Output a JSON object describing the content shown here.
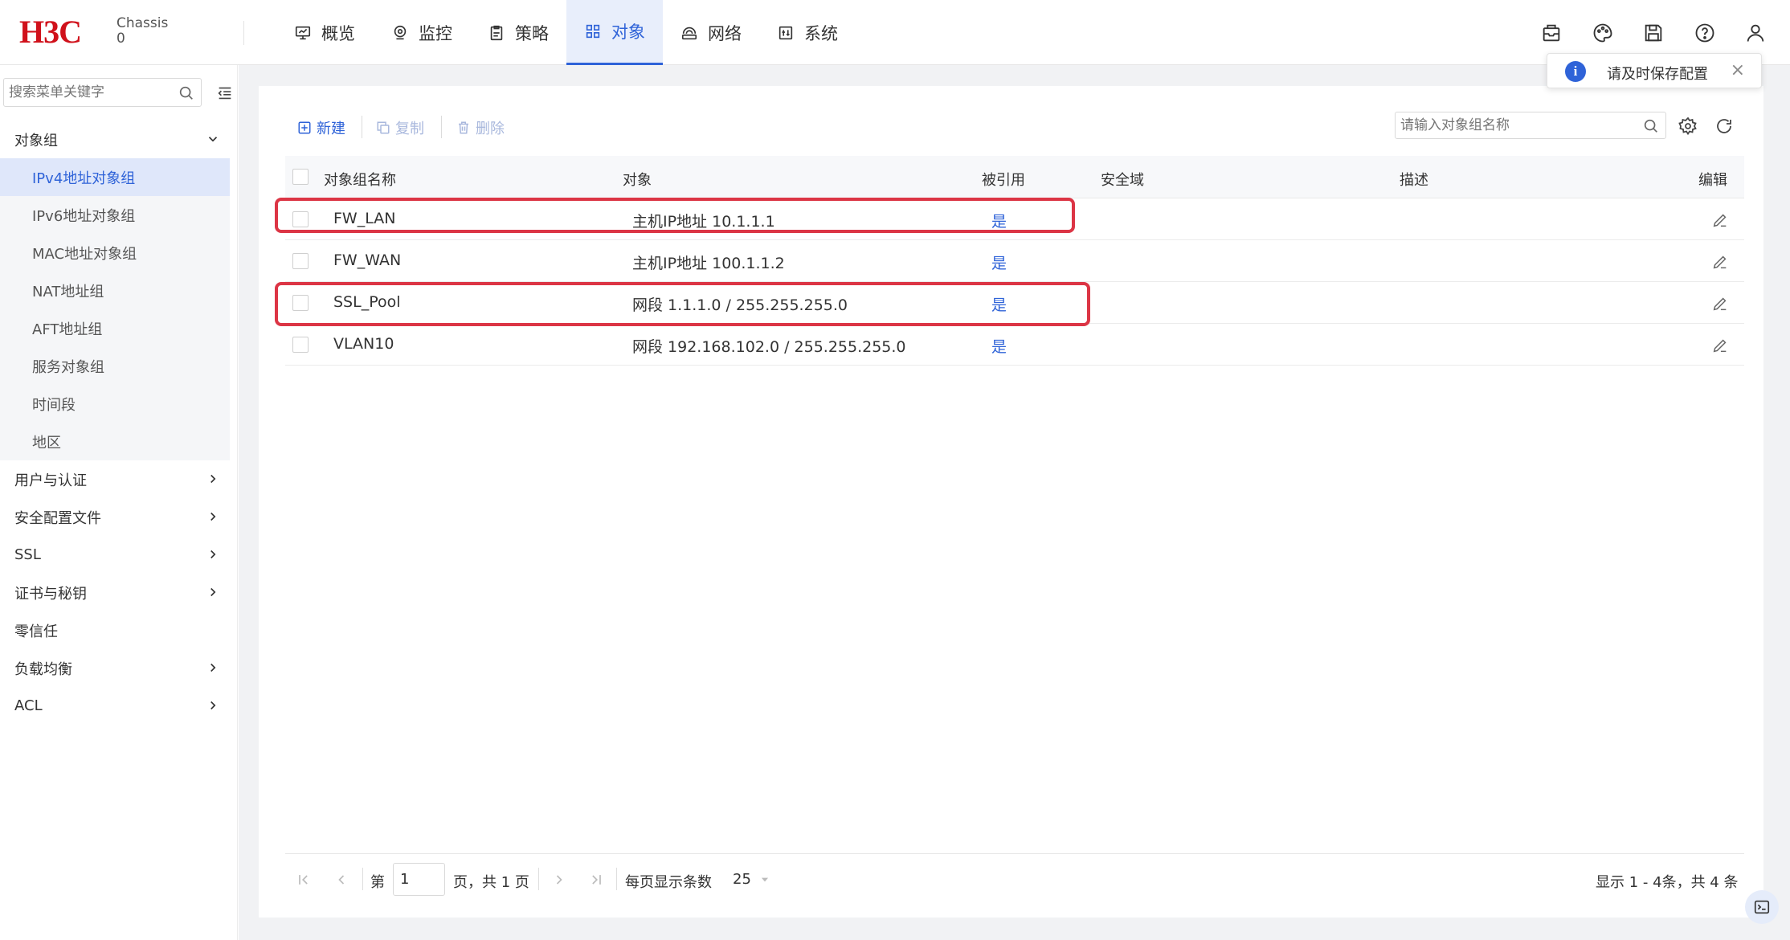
{
  "brand": {
    "logo": "H3C",
    "device": "Chassis",
    "slot": "0"
  },
  "nav": {
    "tabs": [
      {
        "label": "概览",
        "icon": "monitor-icon"
      },
      {
        "label": "监控",
        "icon": "location-pin-icon"
      },
      {
        "label": "策略",
        "icon": "clipboard-icon"
      },
      {
        "label": "对象",
        "icon": "grid-icon",
        "active": true
      },
      {
        "label": "网络",
        "icon": "network-icon"
      },
      {
        "label": "系统",
        "icon": "system-icon"
      }
    ],
    "right_icons": [
      "mailbox-icon",
      "palette-icon",
      "save-icon",
      "help-icon",
      "user-icon"
    ]
  },
  "toast": {
    "message": "请及时保存配置"
  },
  "sidebar": {
    "search_placeholder": "搜索菜单关键字",
    "group": {
      "label": "对象组",
      "expanded": true
    },
    "sub_items": [
      {
        "label": "IPv4地址对象组",
        "active": true
      },
      {
        "label": "IPv6地址对象组"
      },
      {
        "label": "MAC地址对象组"
      },
      {
        "label": "NAT地址组"
      },
      {
        "label": "AFT地址组"
      },
      {
        "label": "服务对象组"
      },
      {
        "label": "时间段"
      },
      {
        "label": "地区"
      }
    ],
    "items": [
      {
        "label": "用户与认证",
        "chevron": true
      },
      {
        "label": "安全配置文件",
        "chevron": true
      },
      {
        "label": "SSL",
        "chevron": true
      },
      {
        "label": "证书与秘钥",
        "chevron": true
      },
      {
        "label": "零信任",
        "chevron": false
      },
      {
        "label": "负载均衡",
        "chevron": true
      },
      {
        "label": "ACL",
        "chevron": true
      }
    ]
  },
  "toolbar": {
    "new_label": "新建",
    "copy_label": "复制",
    "delete_label": "删除",
    "search_placeholder": "请输入对象组名称"
  },
  "table": {
    "columns": [
      "对象组名称",
      "对象",
      "被引用",
      "安全域",
      "描述",
      "编辑"
    ],
    "rows": [
      {
        "name": "FW_LAN",
        "object": "主机IP地址 10.1.1.1",
        "referenced": "是",
        "zone": "",
        "desc": "",
        "highlighted": true
      },
      {
        "name": "FW_WAN",
        "object": "主机IP地址 100.1.1.2",
        "referenced": "是",
        "zone": "",
        "desc": "",
        "highlighted": false
      },
      {
        "name": "SSL_Pool",
        "object": "网段 1.1.1.0 / 255.255.255.0",
        "referenced": "是",
        "zone": "",
        "desc": "",
        "highlighted": true
      },
      {
        "name": "VLAN10",
        "object": "网段 192.168.102.0 / 255.255.255.0",
        "referenced": "是",
        "zone": "",
        "desc": "",
        "highlighted": false
      }
    ]
  },
  "pager": {
    "page_prefix": "第",
    "page_value": "1",
    "page_suffix": "页，共 1 页",
    "per_page_label": "每页显示条数",
    "per_page_value": "25",
    "summary": "显示 1 - 4条，共 4 条"
  },
  "colors": {
    "accent": "#2f63d8",
    "brand": "#d0111b",
    "highlight": "#dc3545"
  }
}
